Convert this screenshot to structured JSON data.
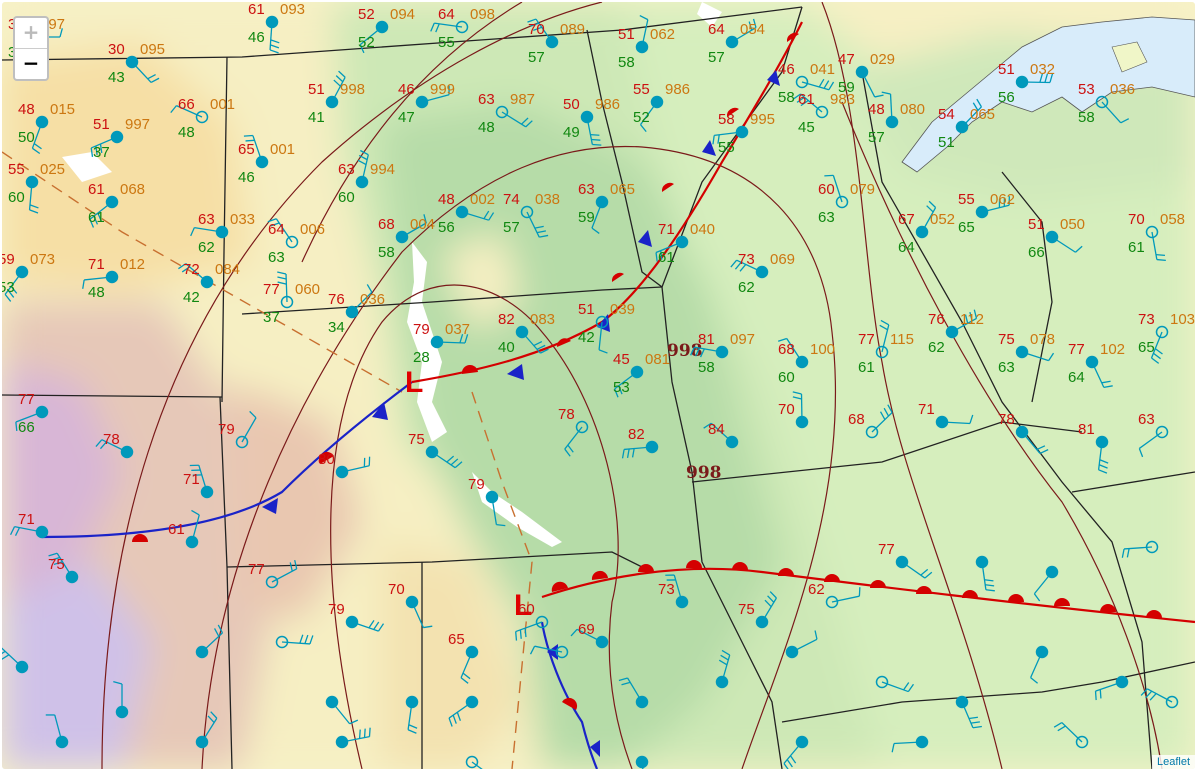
{
  "controls": {
    "zoom_in": "+",
    "zoom_out": "−"
  },
  "attribution": "Leaflet",
  "colors": {
    "temp": "#cc1111",
    "dewpoint": "#118811",
    "pressure": "#cc7711",
    "station": "#0099bb",
    "cold_front": "#1a23c8",
    "warm_front": "#d40000",
    "isobar": "#7a1a1a",
    "lake": "#d8ecfa"
  },
  "lows": [
    {
      "label": "L",
      "pressure": "998"
    },
    {
      "label": "L",
      "pressure": "998"
    }
  ],
  "fronts": {
    "cold": "cold-front",
    "warm": "warm-front",
    "stationary": "stationary-front"
  },
  "labels": {
    "temps": [
      "37",
      "30",
      "61",
      "52",
      "64",
      "70",
      "51",
      "64",
      "46",
      "47",
      "48",
      "51",
      "66",
      "65",
      "51",
      "46",
      "63",
      "50",
      "55",
      "58",
      "61",
      "48",
      "54",
      "51",
      "53",
      "55",
      "61",
      "63",
      "64",
      "63",
      "68",
      "48",
      "74",
      "63",
      "71",
      "73",
      "60",
      "67",
      "55",
      "51",
      "70",
      "59",
      "71",
      "72",
      "77",
      "76",
      "79",
      "82",
      "51",
      "45",
      "81",
      "68",
      "77",
      "76",
      "75",
      "77",
      "73",
      "77",
      "78",
      "71",
      "79",
      "80",
      "75",
      "79",
      "78",
      "82",
      "84",
      "70",
      "68",
      "71",
      "78",
      "81",
      "63",
      "71",
      "75",
      "61",
      "77",
      "79",
      "70",
      "65",
      "60",
      "69",
      "73",
      "75",
      "62",
      "77"
    ],
    "dewpoints": [
      "36",
      "43",
      "46",
      "52",
      "55",
      "57",
      "58",
      "57",
      "58",
      "59",
      "50",
      "37",
      "48",
      "46",
      "41",
      "47",
      "48",
      "49",
      "52",
      "55",
      "45",
      "57",
      "51",
      "56",
      "58",
      "60",
      "61",
      "62",
      "63",
      "60",
      "58",
      "56",
      "57",
      "59",
      "61",
      "62",
      "63",
      "64",
      "65",
      "66",
      "61",
      "53",
      "48",
      "42",
      "37",
      "34",
      "28",
      "40",
      "42",
      "53",
      "58",
      "60",
      "61",
      "62",
      "63",
      "64",
      "65",
      "66"
    ],
    "pressures": [
      "097",
      "095",
      "093",
      "094",
      "098",
      "089",
      "062",
      "054",
      "041",
      "029",
      "015",
      "997",
      "001",
      "001",
      "998",
      "999",
      "987",
      "986",
      "986",
      "995",
      "983",
      "080",
      "065",
      "032",
      "036",
      "025",
      "068",
      "033",
      "006",
      "994",
      "004",
      "002",
      "038",
      "065",
      "040",
      "069",
      "079",
      "052",
      "062",
      "050",
      "058",
      "073",
      "012",
      "084",
      "060",
      "036",
      "037",
      "083",
      "039",
      "081",
      "097",
      "100",
      "115",
      "112",
      "078",
      "102",
      "103"
    ]
  }
}
